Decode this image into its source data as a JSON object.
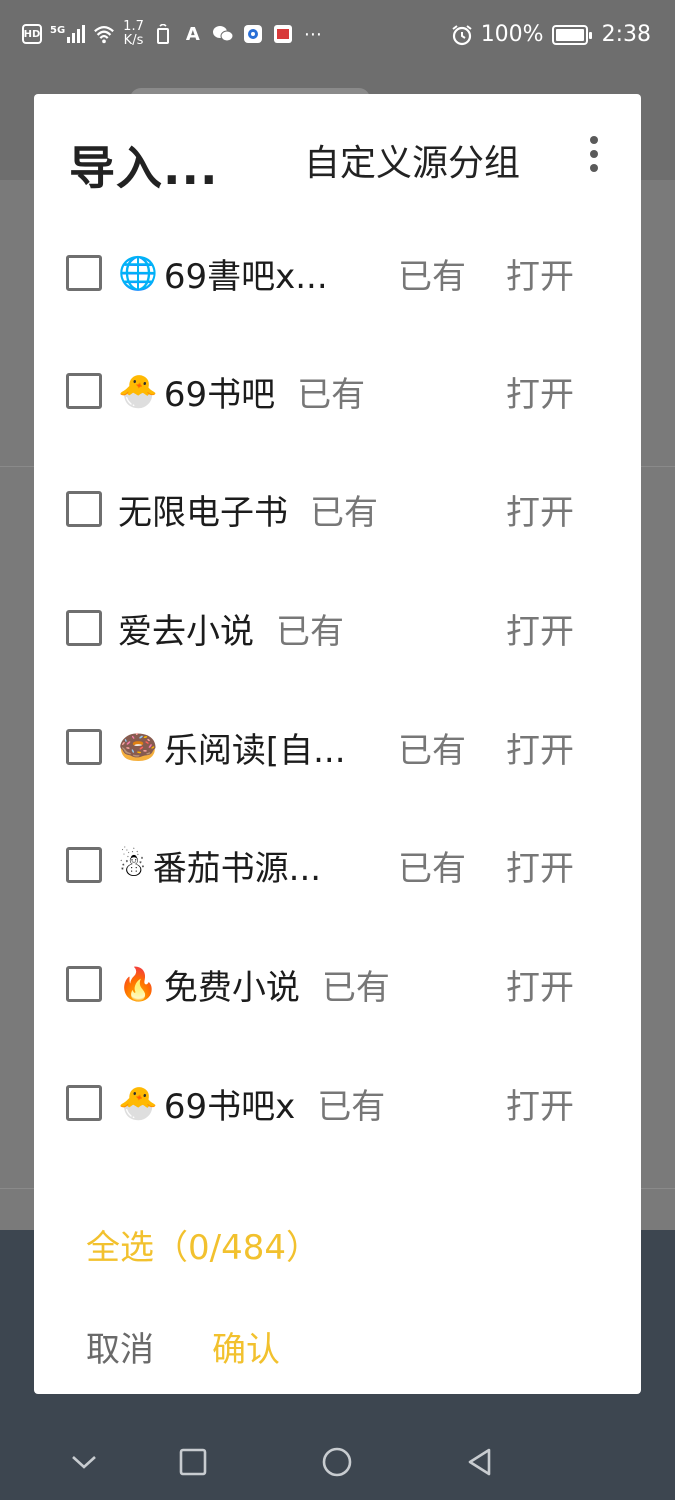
{
  "status_bar": {
    "hd": "HD",
    "signal": "5G",
    "speed_value": "1.7",
    "speed_unit": "K/s",
    "battery": "100%",
    "time": "2:38",
    "icons": [
      "hd-icon",
      "signal-icon",
      "wifi-icon",
      "sim-icon",
      "font-icon",
      "wechat-icon",
      "app-icon",
      "app-icon-2",
      "more-icon",
      "alarm-icon",
      "battery-icon"
    ]
  },
  "dialog": {
    "title": "导入...",
    "group_label": "自定义源分组",
    "items": [
      {
        "emoji": "🌐",
        "name": "69書吧x...",
        "status": "已有",
        "action": "打开"
      },
      {
        "emoji": "🐣",
        "name": "69书吧",
        "status": "已有",
        "action": "打开"
      },
      {
        "emoji": "",
        "name": "无限电子书",
        "status": "已有",
        "action": "打开"
      },
      {
        "emoji": "",
        "name": "爱去小说",
        "status": "已有",
        "action": "打开"
      },
      {
        "emoji": "🍩",
        "name": "乐阅读[自...",
        "status": "已有",
        "action": "打开"
      },
      {
        "emoji": "☃",
        "name": "番茄书源...",
        "status": "已有",
        "action": "打开"
      },
      {
        "emoji": "🔥",
        "name": "免费小说",
        "status": "已有",
        "action": "打开"
      },
      {
        "emoji": "🐣",
        "name": "69书吧x",
        "status": "已有",
        "action": "打开"
      }
    ],
    "select_all": "全选（0/484）",
    "cancel": "取消",
    "confirm": "确认"
  },
  "colors": {
    "accent": "#f2c12e",
    "text_primary": "#1c1c1c",
    "text_secondary": "#777777"
  }
}
